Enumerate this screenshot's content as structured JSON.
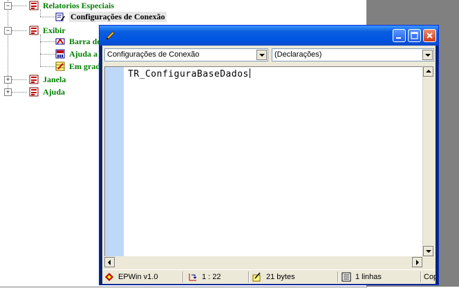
{
  "tree": {
    "items": [
      {
        "label": "Relatorios Especiais",
        "expander": "−",
        "level": 0
      },
      {
        "label": "Configurações de Conexão",
        "level": 1,
        "selected": true
      },
      {
        "label": "Exibir",
        "expander": "−",
        "level": 0
      },
      {
        "label": "Barra de",
        "level": 1
      },
      {
        "label": "Ajuda a",
        "level": 1
      },
      {
        "label": "Em grad",
        "level": 1
      },
      {
        "label": "Janela",
        "expander": "+",
        "level": 0
      },
      {
        "label": "Ajuda",
        "expander": "+",
        "level": 0
      }
    ]
  },
  "editor": {
    "combo_left": "Configurações de Conexão",
    "combo_right": "(Declarações)",
    "code_text": "TR_ConfiguraBaseDados"
  },
  "status": {
    "app": "EPWin v1.0",
    "position": "1 : 22",
    "size": "21 bytes",
    "lines": "1 linhas",
    "extra": "Copy"
  },
  "colors": {
    "tree_text": "#008000",
    "gutter": "#c0d8f8",
    "title_blue": "#0054e3",
    "close_red": "#cf3d16"
  }
}
